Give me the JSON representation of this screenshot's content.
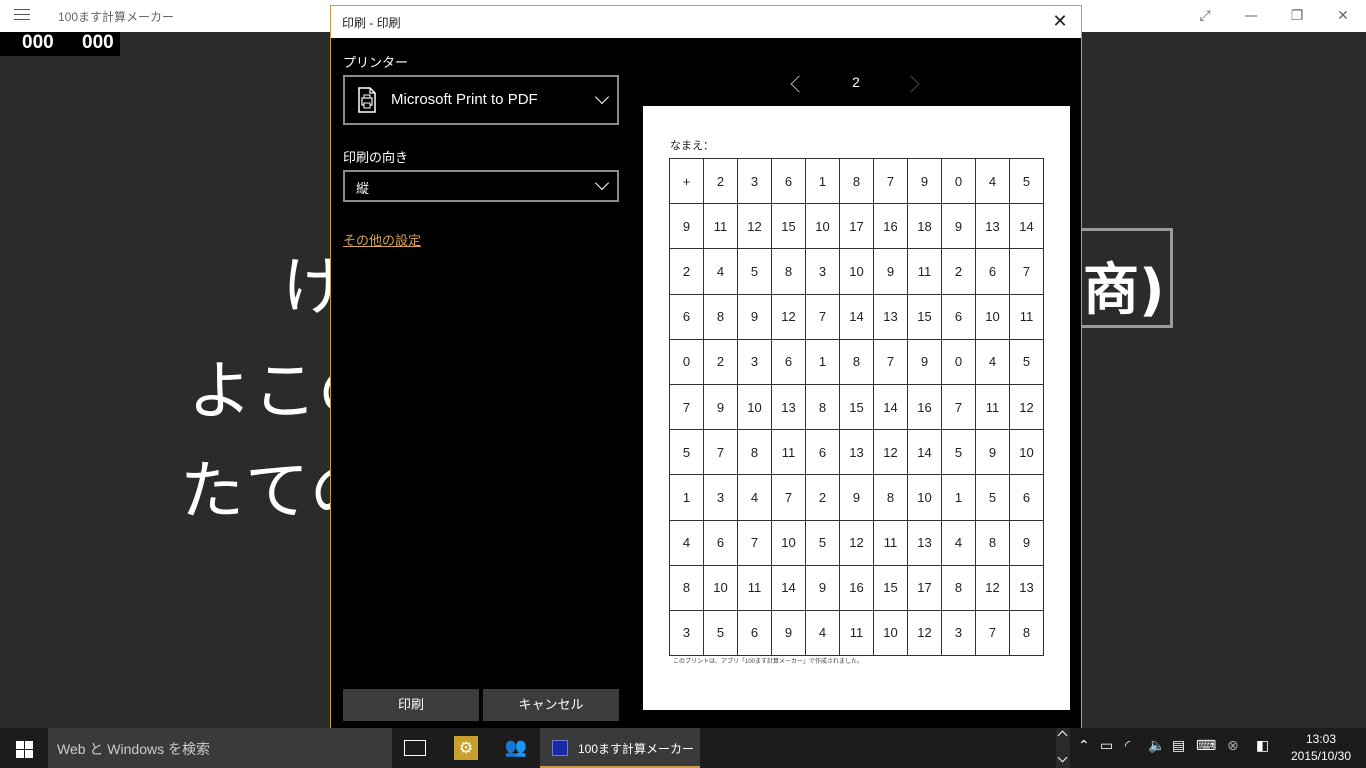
{
  "app": {
    "title": "100ます計算メーカー",
    "counter_left": "000",
    "counter_right": "000",
    "bg_line1": "け",
    "bg_line2": "よこの",
    "bg_line3": "たての",
    "bg_box_text": "商)"
  },
  "dialog": {
    "title": "印刷 - 印刷",
    "printer_label": "プリンター",
    "printer_name": "Microsoft Print to PDF",
    "orientation_label": "印刷の向き",
    "orientation_value": "縦",
    "more_settings": "その他の設定",
    "print_button": "印刷",
    "cancel_button": "キャンセル",
    "page_number": "2"
  },
  "preview": {
    "name_label": "なまえ：",
    "grid": [
      [
        "+",
        "2",
        "3",
        "6",
        "1",
        "8",
        "7",
        "9",
        "0",
        "4",
        "5"
      ],
      [
        "9",
        "11",
        "12",
        "15",
        "10",
        "17",
        "16",
        "18",
        "9",
        "13",
        "14"
      ],
      [
        "2",
        "4",
        "5",
        "8",
        "3",
        "10",
        "9",
        "11",
        "2",
        "6",
        "7"
      ],
      [
        "6",
        "8",
        "9",
        "12",
        "7",
        "14",
        "13",
        "15",
        "6",
        "10",
        "11"
      ],
      [
        "0",
        "2",
        "3",
        "6",
        "1",
        "8",
        "7",
        "9",
        "0",
        "4",
        "5"
      ],
      [
        "7",
        "9",
        "10",
        "13",
        "8",
        "15",
        "14",
        "16",
        "7",
        "11",
        "12"
      ],
      [
        "5",
        "7",
        "8",
        "11",
        "6",
        "13",
        "12",
        "14",
        "5",
        "9",
        "10"
      ],
      [
        "1",
        "3",
        "4",
        "7",
        "2",
        "9",
        "8",
        "10",
        "1",
        "5",
        "6"
      ],
      [
        "4",
        "6",
        "7",
        "10",
        "5",
        "12",
        "11",
        "13",
        "4",
        "8",
        "9"
      ],
      [
        "8",
        "10",
        "11",
        "14",
        "9",
        "16",
        "15",
        "17",
        "8",
        "12",
        "13"
      ],
      [
        "3",
        "5",
        "6",
        "9",
        "4",
        "11",
        "10",
        "12",
        "3",
        "7",
        "8"
      ]
    ],
    "footnote": "このプリントは、アプリ「100ます計算メーカー」で作成されました。"
  },
  "taskbar": {
    "search_placeholder": "Web と Windows を検索",
    "active_app_label": "100ます計算メーカー",
    "time": "13:03",
    "date": "2015/10/30"
  },
  "colors": {
    "accent": "#c89a4a",
    "link": "#d9a055",
    "dialog_bg": "#000000",
    "app_bg": "#2b2b2b"
  }
}
